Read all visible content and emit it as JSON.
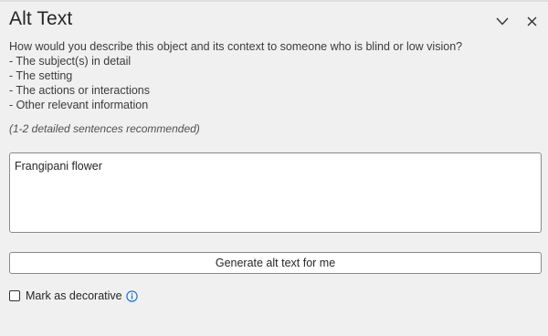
{
  "pane": {
    "title": "Alt Text",
    "collapse_icon": "chevron-down-icon",
    "close_icon": "close-icon"
  },
  "prompt": {
    "question": "How would you describe this object and its context to someone who is blind or low vision?",
    "bullets": [
      "- The subject(s) in detail",
      "- The setting",
      "- The actions or interactions",
      "- Other relevant information"
    ],
    "hint": "(1-2 detailed sentences recommended)"
  },
  "alt_text_input": {
    "value": "Frangipani flower"
  },
  "generate_button": {
    "label": "Generate alt text for me"
  },
  "decorative": {
    "label": "Mark as decorative",
    "checked": false,
    "info_icon": "info-icon"
  },
  "colors": {
    "background": "#f0f0f0",
    "accent": "#0f6cbd",
    "text": "#262626"
  }
}
